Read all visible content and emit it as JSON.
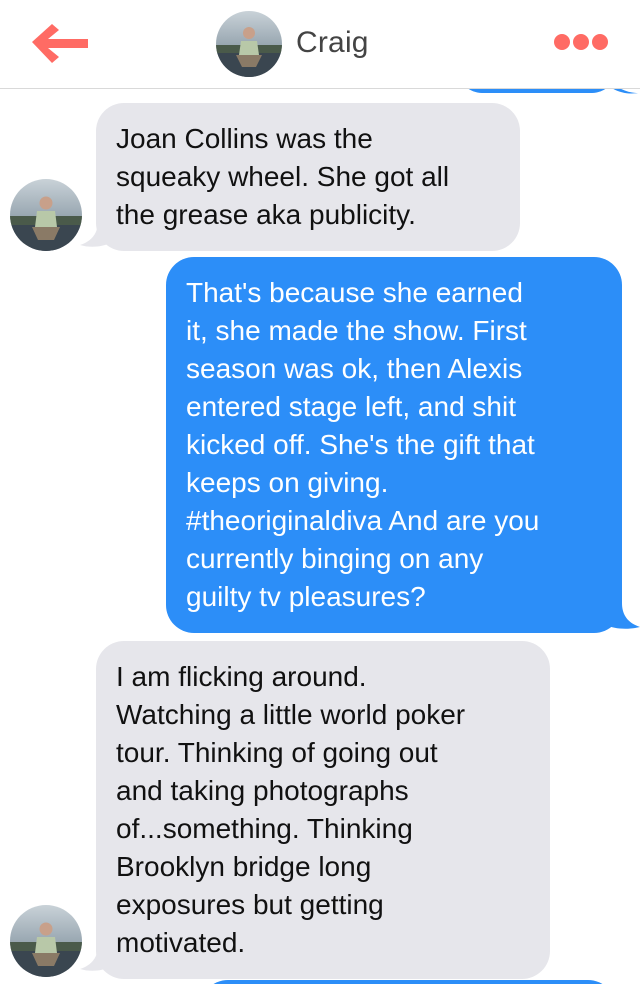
{
  "header": {
    "back_icon": "arrow-left-icon",
    "contact_name": "Craig",
    "more_icon": "ellipsis-icon",
    "accent_color": "#ff6b64"
  },
  "messages": [
    {
      "direction": "incoming",
      "lines": [
        "Joan Collins was the",
        "squeaky wheel. She got all",
        "the grease aka publicity."
      ]
    },
    {
      "direction": "outgoing",
      "lines": [
        "That's because she earned",
        "it, she made the show. First",
        "season was ok, then Alexis",
        "entered stage left, and shit",
        "kicked off. She's the gift that",
        "keeps on giving.",
        "#theoriginaldiva And are you",
        "currently binging on any",
        "guilty tv pleasures?"
      ]
    },
    {
      "direction": "incoming",
      "lines": [
        "I am flicking around.",
        "Watching a little world poker",
        "tour. Thinking of going out",
        "and taking photographs",
        "of...something. Thinking",
        "Brooklyn bridge long",
        "exposures but getting",
        "motivated."
      ]
    }
  ],
  "colors": {
    "incoming_bubble": "#e6e6eb",
    "outgoing_bubble": "#2c8ef8"
  }
}
